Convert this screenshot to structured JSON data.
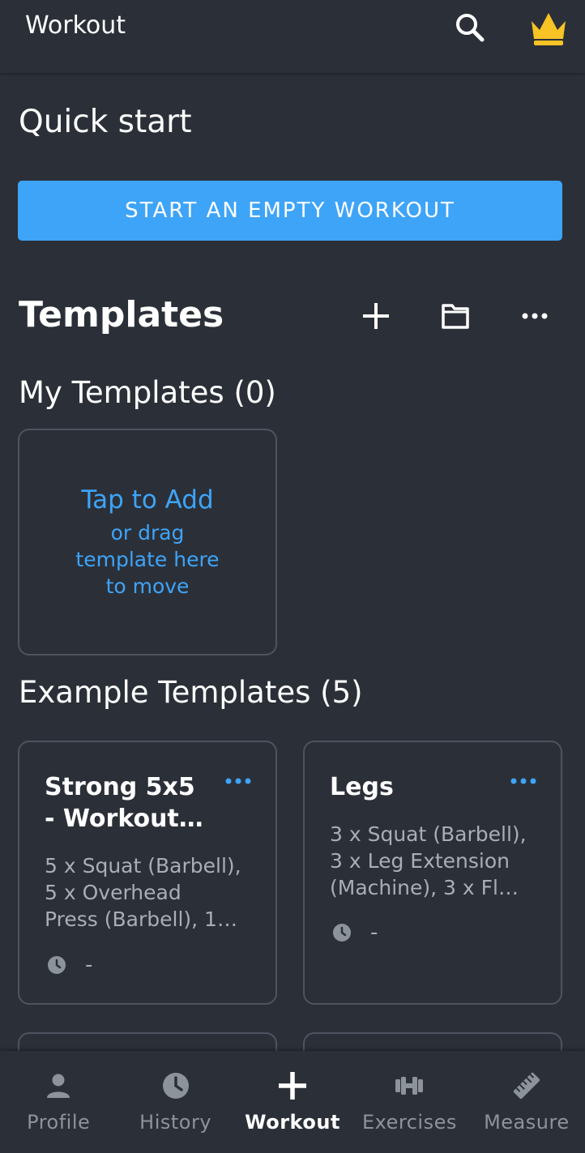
{
  "appbar": {
    "title": "Workout",
    "search_icon": "search-icon",
    "premium_icon": "crown-icon",
    "crown_color": "#f7c325"
  },
  "quick_start": {
    "title": "Quick start",
    "button_label": "START AN EMPTY WORKOUT",
    "button_color": "#3ea4f8"
  },
  "templates": {
    "title": "Templates",
    "actions": [
      "plus-icon",
      "folder-icon",
      "more-horizontal-icon"
    ],
    "my_templates_title": "My Templates (0)",
    "add_card": {
      "primary": "Tap to Add",
      "line1": "or drag",
      "line2": "template here",
      "line3": "to move"
    },
    "example_title": "Example Templates (5)",
    "examples": [
      {
        "title_line1": "Strong 5x5",
        "title_line2": "- Workout…",
        "desc_line1": "5 x Squat (Barbell),",
        "desc_line2": "5 x Overhead",
        "desc_line3": "Press (Barbell), 1…",
        "time": "-"
      },
      {
        "title_line1": "Legs",
        "title_line2": "",
        "desc_line1": "3 x Squat (Barbell),",
        "desc_line2": "3 x Leg Extension",
        "desc_line3": "(Machine), 3 x Fl…",
        "time": "-"
      }
    ]
  },
  "nav": {
    "items": [
      {
        "label": "Profile",
        "icon": "profile-icon"
      },
      {
        "label": "History",
        "icon": "clock-icon"
      },
      {
        "label": "Workout",
        "icon": "plus-icon"
      },
      {
        "label": "Exercises",
        "icon": "dumbbell-icon"
      },
      {
        "label": "Measure",
        "icon": "ruler-icon"
      }
    ],
    "active": "Workout"
  }
}
